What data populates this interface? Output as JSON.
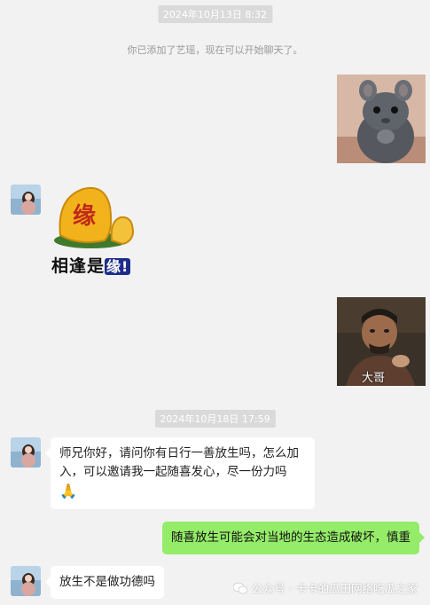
{
  "chat": {
    "timestamp_1": "2024年10月13日 8:32",
    "system_message": "你已添加了艺瑶，现在可以开始聊天了。",
    "sticker_text_main": "相逢是",
    "sticker_text_highlight": "缘!",
    "sticker_seal_char": "缘",
    "meme_caption": "大哥",
    "timestamp_2": "2024年10月18日 17:59",
    "message_1": "师兄你好，请问你有日行一善放生吗，怎么加入，可以邀请我一起随喜发心，尽一份力吗",
    "message_1_emoji": "🙏",
    "message_2": "随喜放生可能会对当地的生态造成破坏，慎重",
    "message_3": "放生不是做功德吗"
  },
  "watermark": {
    "text": "公众号 · 卡卡的瓜田网络吃瓜之家"
  },
  "colors": {
    "background": "#f2f2f2",
    "self_bubble": "#95ec69",
    "other_bubble": "#ffffff",
    "time_badge": "#dadada"
  }
}
